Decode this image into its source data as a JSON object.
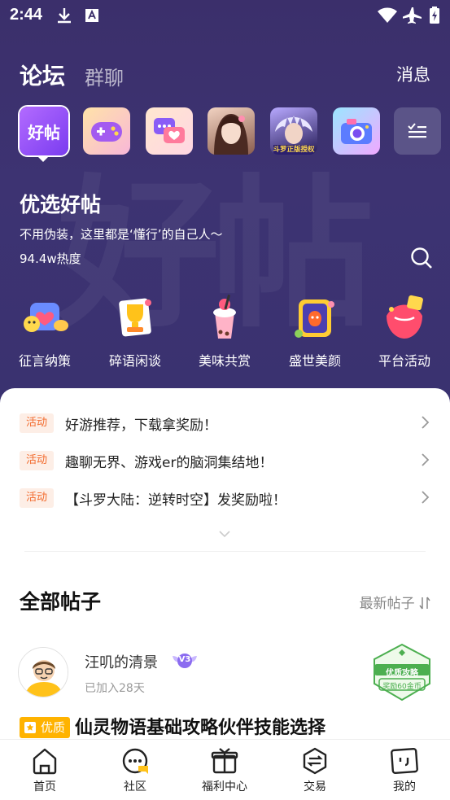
{
  "status_bar": {
    "time": "2:44"
  },
  "header": {
    "tab_active": "论坛",
    "tab_inactive": "群聊",
    "messages": "消息"
  },
  "forum_tiles": [
    {
      "name": "好帖",
      "selected": true
    },
    {
      "name": "game-controller"
    },
    {
      "name": "chat-heart"
    },
    {
      "name": "girl-portrait"
    },
    {
      "name": "warrior-portrait",
      "badge": "斗罗正版授权"
    },
    {
      "name": "camera"
    },
    {
      "name": "more-list"
    }
  ],
  "forum": {
    "title": "优选好帖",
    "description": "不用伪装，这里都是‘懂行’的自己人～",
    "heat": "94.4w热度",
    "watermark": "好帖"
  },
  "categories": [
    {
      "label": "征言纳策",
      "icon": "chat-bubbles-icon"
    },
    {
      "label": "碎语闲谈",
      "icon": "trophy-icon"
    },
    {
      "label": "美味共赏",
      "icon": "milk-tea-icon"
    },
    {
      "label": "盛世美颜",
      "icon": "flower-frame-icon"
    },
    {
      "label": "平台活动",
      "icon": "gift-icon"
    }
  ],
  "activities": [
    {
      "badge": "活动",
      "text": "好游推荐，下载拿奖励！"
    },
    {
      "badge": "活动",
      "text": "趣聊无界、游戏er的脑洞集结地！"
    },
    {
      "badge": "活动",
      "text": "【斗罗大陆：逆转时空】发奖励啦！"
    }
  ],
  "posts_section": {
    "title": "全部帖子",
    "sort": "最新帖子"
  },
  "post": {
    "author": "汪叽的清景",
    "level": "V3",
    "joined": "已加入28天",
    "stamp_top": "优质攻略",
    "stamp_bottom": "奖励60金币",
    "quality_label": "优质",
    "title": "仙灵物语基础攻略伙伴技能选择"
  },
  "bottom_nav": [
    {
      "label": "首页",
      "icon": "home-icon"
    },
    {
      "label": "社区",
      "icon": "community-icon"
    },
    {
      "label": "福利中心",
      "icon": "gift-box-icon"
    },
    {
      "label": "交易",
      "icon": "trade-icon"
    },
    {
      "label": "我的",
      "icon": "profile-icon"
    }
  ],
  "colors": {
    "hero_bg": "#3b2f6b",
    "accent": "#f26a2c",
    "quality": "#ffb300",
    "stamp_green": "#4caf50"
  }
}
